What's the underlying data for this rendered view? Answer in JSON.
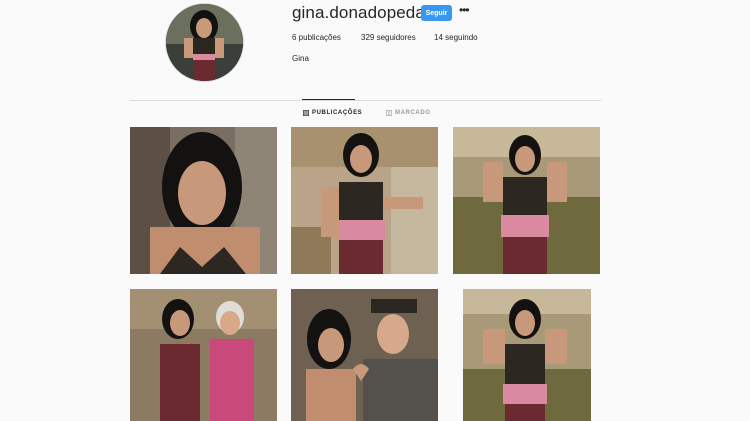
{
  "profile": {
    "username": "gina.donadopedaco",
    "follow_label": "Seguir",
    "more_icon": "more-options-icon",
    "full_name": "Gina",
    "stats": {
      "posts": "6 publicações",
      "followers": "329 seguidores",
      "following": "14 seguindo"
    }
  },
  "tabs": [
    {
      "label": "PUBLICAÇÕES",
      "icon": "grid-icon",
      "active": true
    },
    {
      "label": "MARCADO",
      "icon": "tagged-icon",
      "active": false
    }
  ],
  "colors": {
    "follow_button": "#3897f0",
    "background": "#fafafa",
    "divider": "#dbdbdb"
  },
  "posts": [
    {
      "id": 1
    },
    {
      "id": 2
    },
    {
      "id": 3
    },
    {
      "id": 4
    },
    {
      "id": 5
    },
    {
      "id": 6
    }
  ]
}
